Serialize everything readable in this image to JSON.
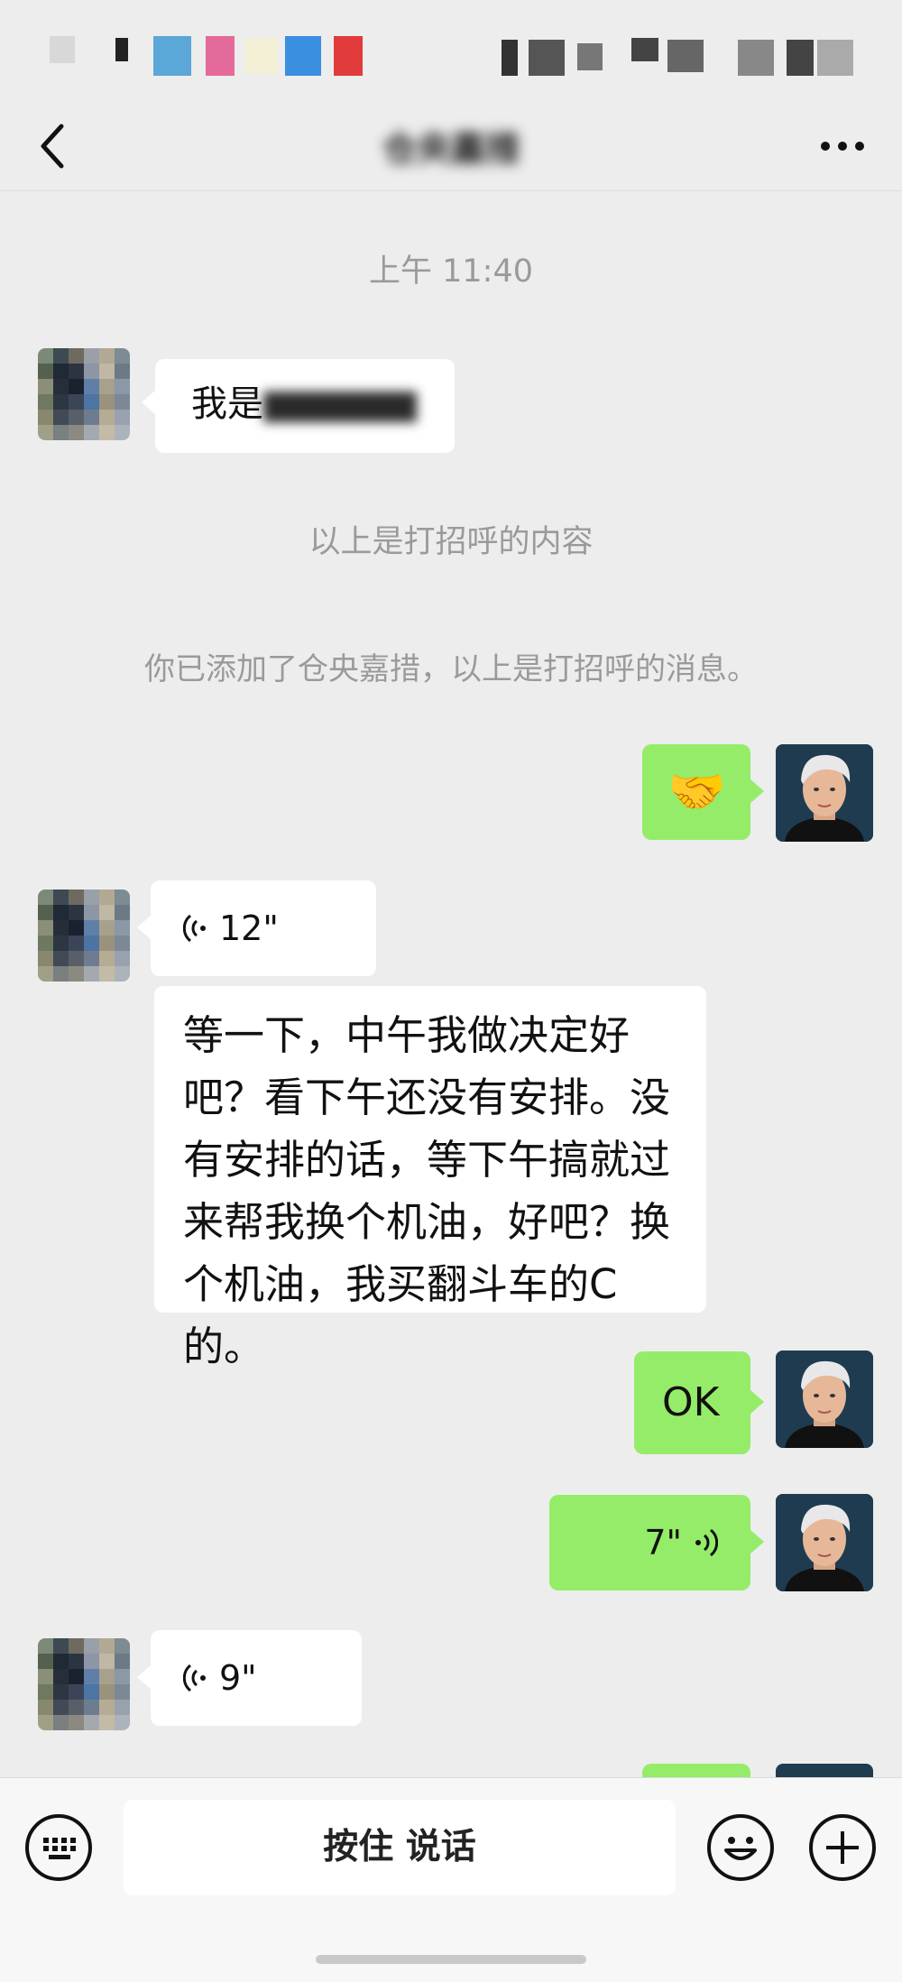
{
  "header": {
    "title": "仓央嘉措",
    "back_icon": "chevron-left-icon",
    "more_icon": "more-dots-icon"
  },
  "messages": {
    "timestamp": "上午 11:40",
    "greeting_partial": "我是",
    "greeting_label": "以上是打招呼的内容",
    "added_notice": "你已添加了仓央嘉措，以上是打招呼的消息。",
    "handshake_emoji": "🤝",
    "voice_1_duration": "12\"",
    "text_long": "等一下，中午我做决定好吧？看下午还没有安排。没有安排的话，等下午搞就过来帮我换个机油，好吧？换个机油，我买翻斗车的C的。",
    "ok_text": "OK",
    "voice_2_duration": "7\"",
    "voice_3_duration": "9\""
  },
  "input_bar": {
    "talk_label": "按住 说话",
    "keyboard_icon": "keyboard-icon",
    "emoji_icon": "emoji-face-icon",
    "plus_icon": "plus-circle-icon"
  },
  "colors": {
    "background": "#ededed",
    "sent_bubble": "#95ec69",
    "received_bubble": "#ffffff",
    "system_text": "#9a9a9a"
  }
}
